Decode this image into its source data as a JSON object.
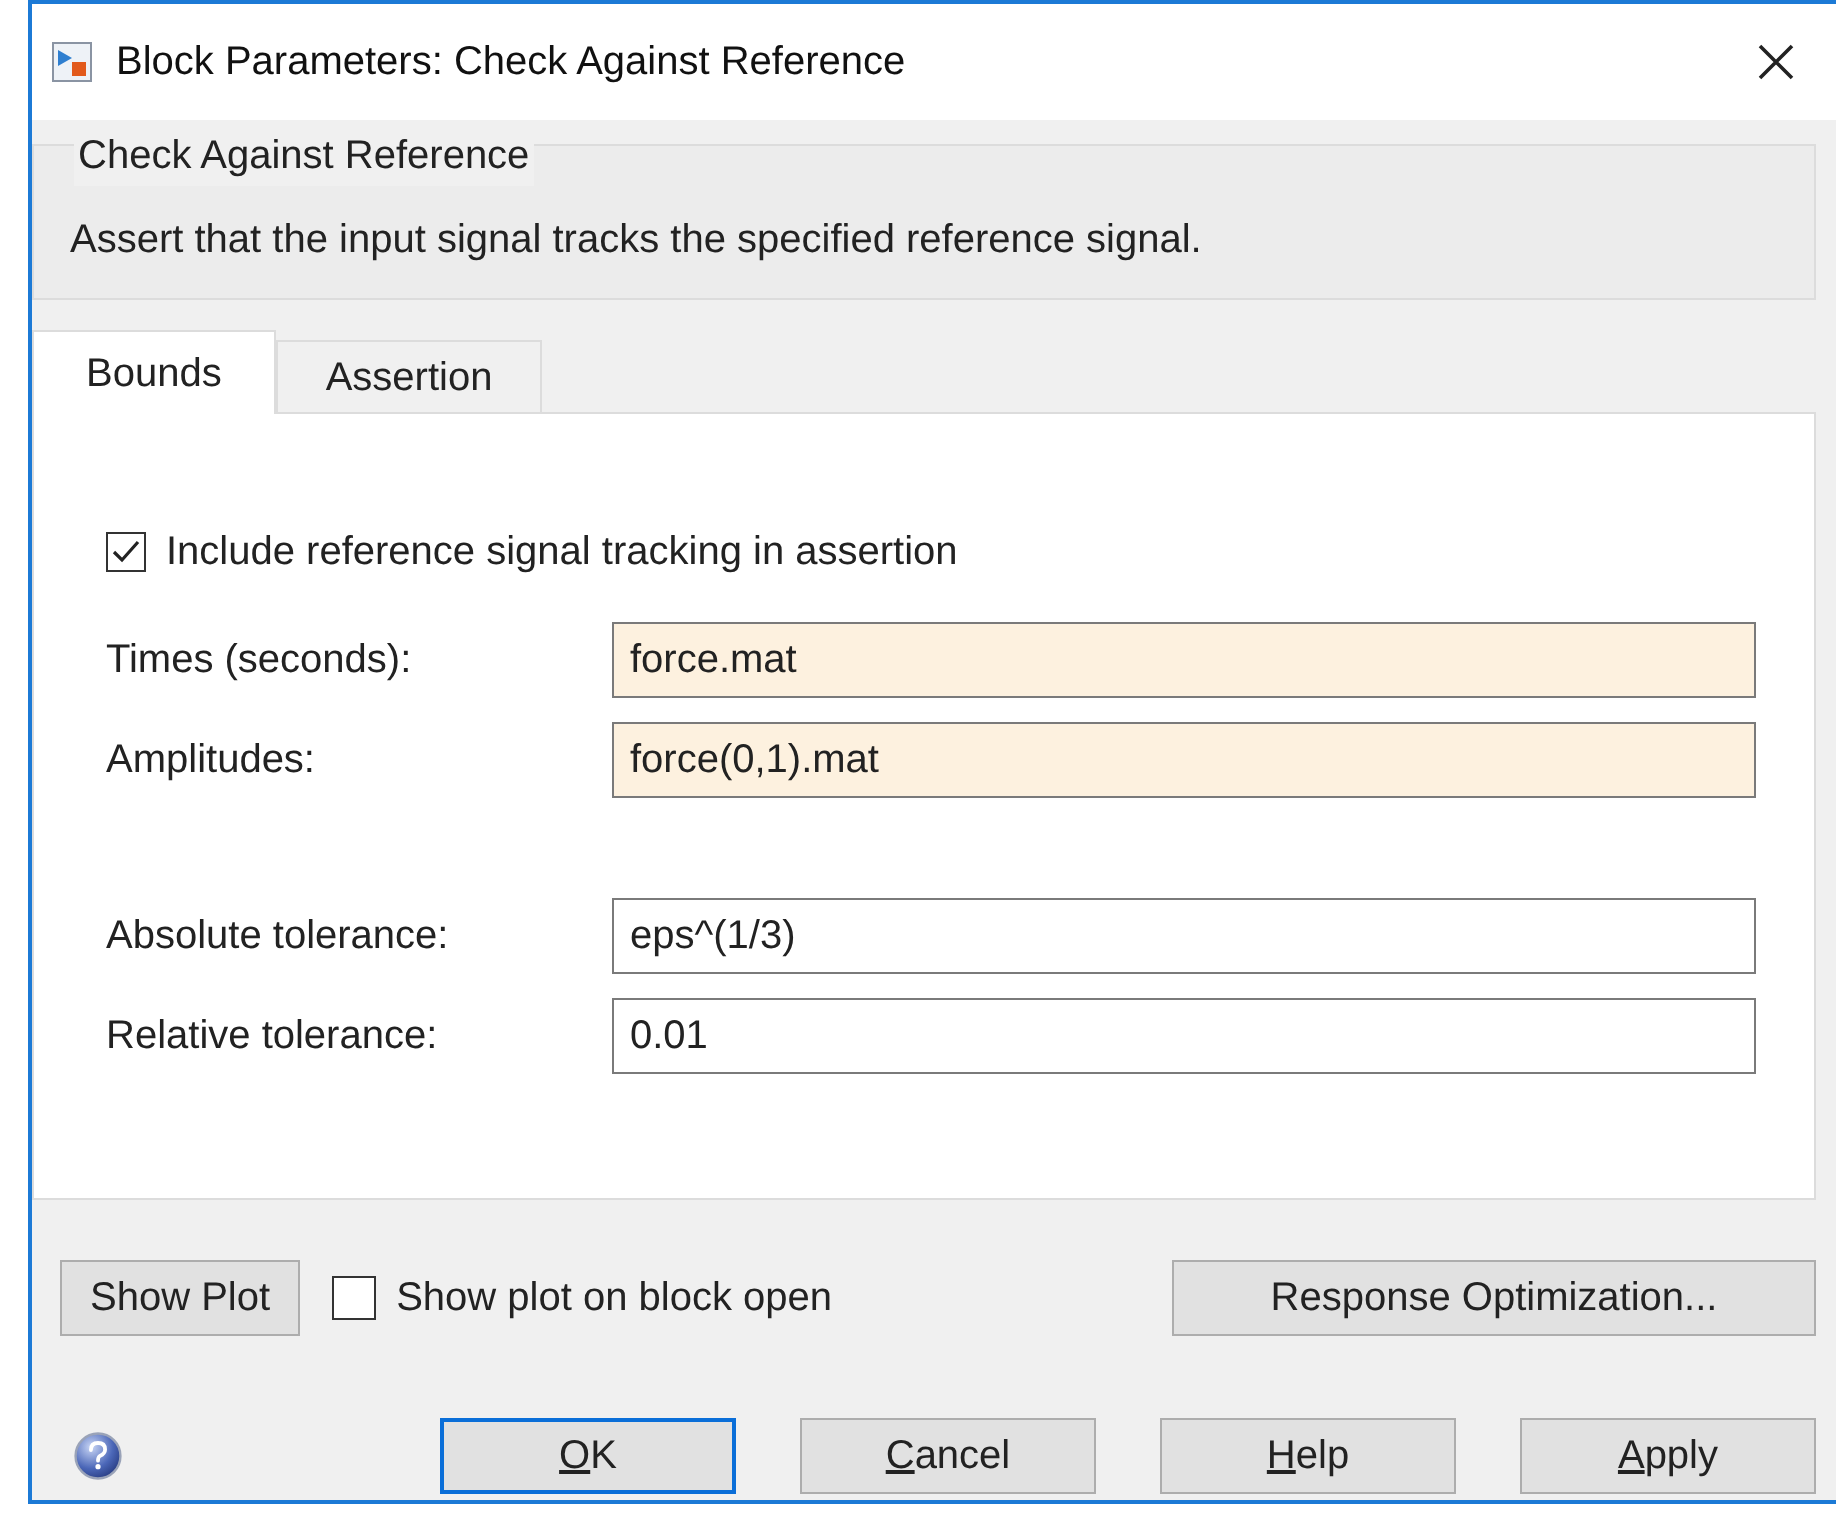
{
  "window": {
    "title": "Block Parameters: Check Against Reference"
  },
  "group": {
    "title": "Check Against Reference",
    "description": "Assert that the input signal tracks the specified reference signal."
  },
  "tabs": [
    {
      "label": "Bounds",
      "selected": true
    },
    {
      "label": "Assertion",
      "selected": false
    }
  ],
  "tracking_checkbox": {
    "label": "Include reference signal tracking in assertion",
    "checked": true
  },
  "fields": [
    {
      "label": "Times (seconds):",
      "value": "force.mat",
      "highlighted": true
    },
    {
      "label": "Amplitudes:",
      "value": "force(0,1).mat",
      "highlighted": true
    },
    {
      "label": "Absolute tolerance:",
      "value": "eps^(1/3)",
      "highlighted": false
    },
    {
      "label": "Relative tolerance:",
      "value": "0.01",
      "highlighted": false
    }
  ],
  "show_plot_button": "Show Plot",
  "show_plot_checkbox": {
    "label": "Show plot on block open",
    "checked": false
  },
  "response_button": "Response Optimization...",
  "buttons": [
    {
      "label": "OK",
      "selected": true
    },
    {
      "label": "Cancel",
      "selected": false
    },
    {
      "label": "Help",
      "selected": false
    },
    {
      "label": "Apply",
      "selected": false
    }
  ]
}
